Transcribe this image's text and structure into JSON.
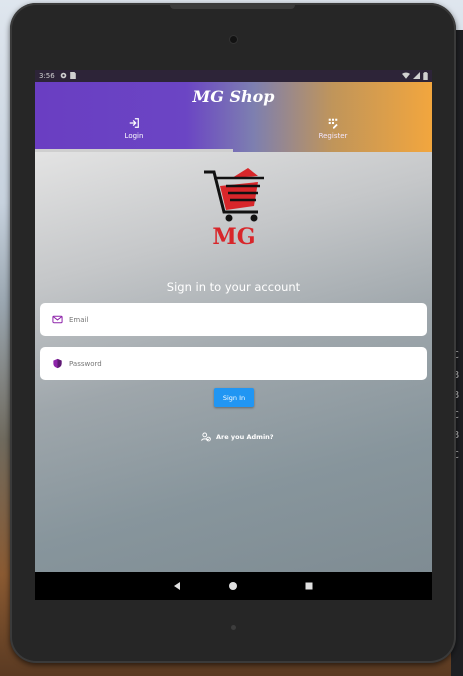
{
  "status_bar": {
    "time": "3:56",
    "left_icons": [
      "settings-icon",
      "sim-card-icon"
    ],
    "right_icons": [
      "wifi-icon",
      "signal-icon",
      "battery-icon"
    ]
  },
  "app": {
    "title": "MG Shop",
    "gradient_colors": [
      "#6a3ec2",
      "#f2a63e"
    ]
  },
  "tabs": [
    {
      "label": "Login",
      "icon": "login-icon",
      "selected": true
    },
    {
      "label": "Register",
      "icon": "register-icon",
      "selected": false
    }
  ],
  "logo": {
    "name": "cart-logo",
    "text": "MG",
    "colors": [
      "#111111",
      "#d8262a"
    ]
  },
  "form": {
    "heading": "Sign in to your account",
    "email": {
      "placeholder": "Email",
      "value": "",
      "icon": "mail-icon"
    },
    "password": {
      "placeholder": "Password",
      "value": "",
      "icon": "shield-icon"
    },
    "submit_label": "Sign In",
    "admin_link": "Are you Admin?",
    "admin_icon": "admin-person-icon",
    "accent": "#2196f3",
    "icon_color": "#8e24aa"
  },
  "navbar": {
    "buttons": [
      "back-icon",
      "home-icon",
      "recents-icon"
    ]
  }
}
